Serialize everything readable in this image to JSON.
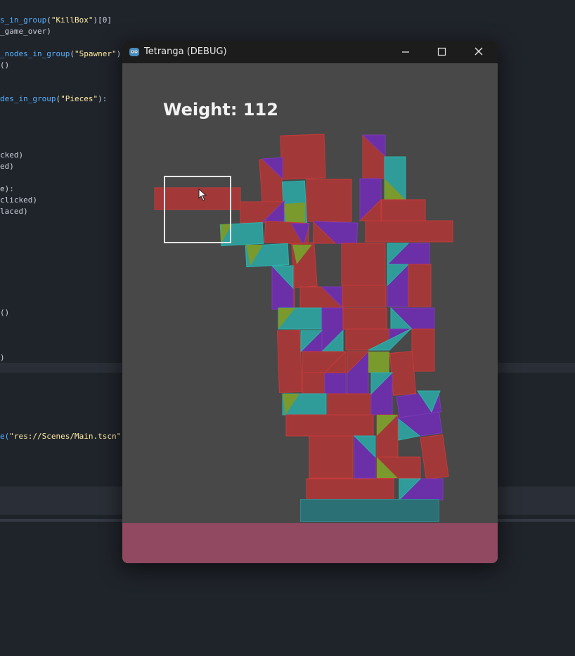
{
  "editor": {
    "lines": [
      {
        "pre": "",
        "fn": "s_in_group",
        "str": "\"KillBox\"",
        "post": ")[0]"
      },
      {
        "pre": "_game_over)",
        "fn": "",
        "str": "",
        "post": ""
      },
      {
        "pre": "",
        "fn": "_nodes_in_group",
        "str": "\"Spawner\"",
        "post": ")"
      },
      {
        "pre": "()",
        "fn": "",
        "str": "",
        "post": ""
      },
      {
        "pre": "",
        "fn": "des_in_group",
        "str": "\"Pieces\"",
        "post": "):"
      },
      {
        "pre": "cked)",
        "fn": "",
        "str": "",
        "post": ""
      },
      {
        "pre": "ed)",
        "fn": "",
        "str": "",
        "post": ""
      },
      {
        "pre": "e):",
        "fn": "",
        "str": "",
        "post": ""
      },
      {
        "pre": "clicked)",
        "fn": "",
        "str": "",
        "post": ""
      },
      {
        "pre": "laced)",
        "fn": "",
        "str": "",
        "post": ""
      },
      {
        "pre": "()",
        "fn": "",
        "str": "",
        "post": ""
      },
      {
        "pre": ")",
        "fn": "",
        "str": "",
        "post": ""
      },
      {
        "pre": "",
        "fn": "e(",
        "str": "\"res://Scenes/Main.tscn\"",
        "post": ""
      }
    ]
  },
  "window": {
    "title": "Tetranga (DEBUG)",
    "minimize": "minimize",
    "maximize": "maximize",
    "close": "close"
  },
  "game": {
    "weight_label": "Weight: 112"
  },
  "colors": {
    "red": "#a33838",
    "teal": "#2f9c9a",
    "purple": "#6b2fa8",
    "olive": "#7a9a2e",
    "ground": "#904960",
    "platform": "#2b7075"
  }
}
